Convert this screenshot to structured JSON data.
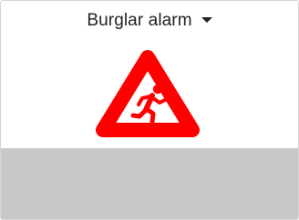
{
  "widget": {
    "selected_option": "Burglar alarm"
  },
  "icons": {
    "dropdown_caret": "caret-down-icon",
    "alert": "burglar-warning-icon"
  },
  "colors": {
    "alert_red": "#ff0000",
    "panel_gray": "#c8c8c8",
    "text": "#222222"
  }
}
